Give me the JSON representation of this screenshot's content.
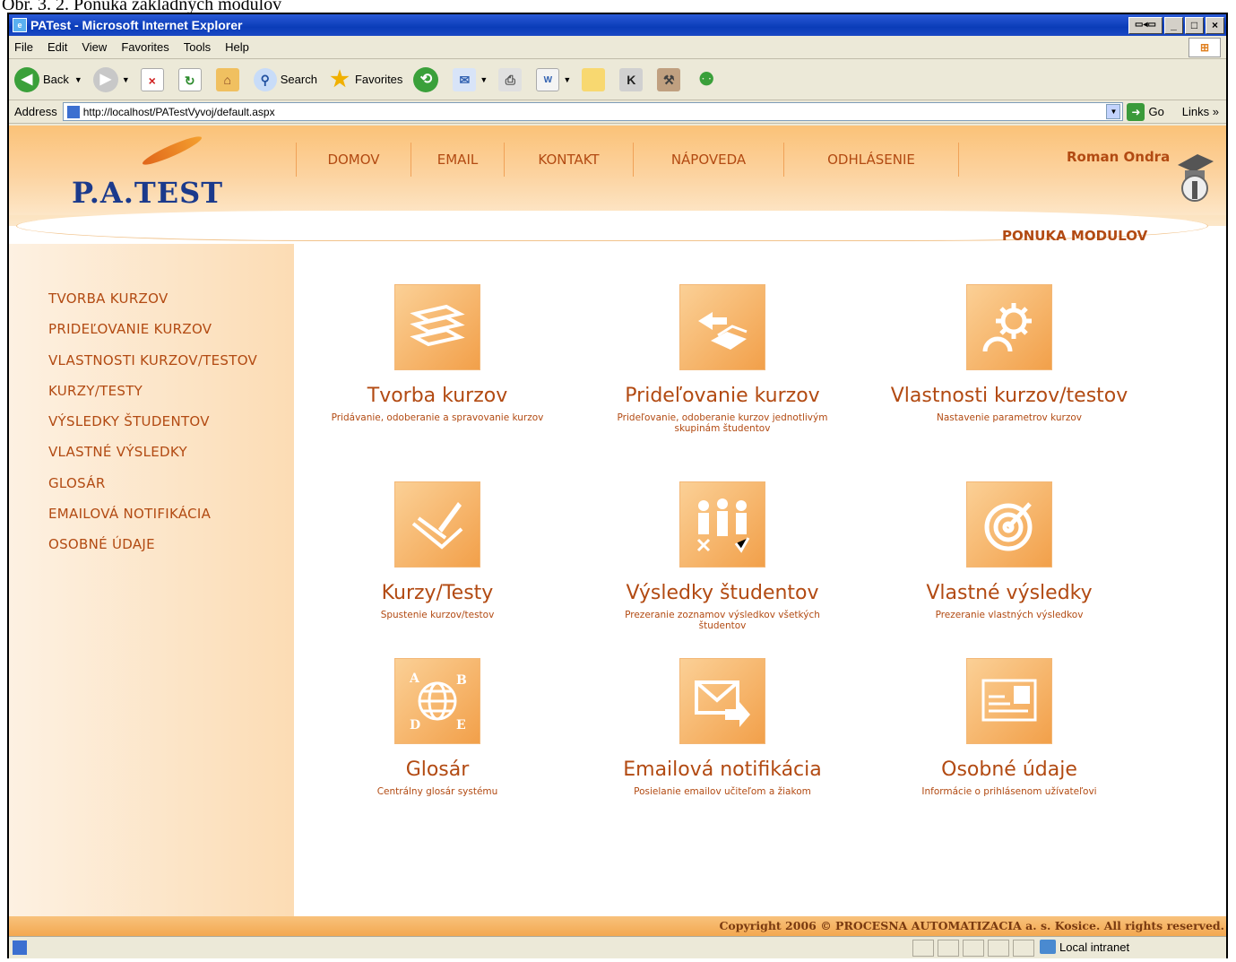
{
  "caption": "Obr. 3. 2. Ponuka základných modulov",
  "window": {
    "title": "PATest - Microsoft Internet Explorer"
  },
  "menubar": [
    "File",
    "Edit",
    "View",
    "Favorites",
    "Tools",
    "Help"
  ],
  "toolbar": {
    "back": "Back",
    "search": "Search",
    "favorites": "Favorites"
  },
  "address": {
    "label": "Address",
    "url": "http://localhost/PATestVyvoj/default.aspx",
    "go": "Go",
    "links": "Links"
  },
  "site": {
    "logo": "P.A.TEST",
    "nav": [
      "DOMOV",
      "EMAIL",
      "KONTAKT",
      "NÁPOVEDA",
      "ODHLÁSENIE"
    ],
    "user": "Roman Ondra",
    "section_title": "PONUKA MODULOV"
  },
  "sidebar": {
    "items": [
      "TVORBA KURZOV",
      "PRIDEĽOVANIE KURZOV",
      "VLASTNOSTI KURZOV/TESTOV",
      "KURZY/TESTY",
      "VÝSLEDKY ŠTUDENTOV",
      "VLASTNÉ VÝSLEDKY",
      "GLOSÁR",
      "EMAILOVÁ NOTIFIKÁCIA",
      "OSOBNÉ ÚDAJE"
    ]
  },
  "modules": [
    {
      "title": "Tvorba kurzov",
      "desc": "Pridávanie, odoberanie a spravovanie kurzov",
      "icon": "books-icon"
    },
    {
      "title": "Prideľovanie kurzov",
      "desc": "Prideľovanie, odoberanie kurzov jednotlivým skupinám študentov",
      "icon": "assign-book-icon"
    },
    {
      "title": "Vlastnosti kurzov/testov",
      "desc": "Nastavenie parametrov kurzov",
      "icon": "gears-icon"
    },
    {
      "title": "Kurzy/Testy",
      "desc": "Spustenie kurzov/testov",
      "icon": "pen-notebook-icon"
    },
    {
      "title": "Výsledky študentov",
      "desc": "Prezeranie zoznamov výsledkov všetkých študentov",
      "icon": "students-icon"
    },
    {
      "title": "Vlastné výsledky",
      "desc": "Prezeranie vlastných výsledkov",
      "icon": "target-icon"
    },
    {
      "title": "Glosár",
      "desc": "Centrálny glosár systému",
      "icon": "globe-letters-icon"
    },
    {
      "title": "Emailová notifikácia",
      "desc": "Posielanie emailov učiteľom a žiakom",
      "icon": "envelope-icon"
    },
    {
      "title": "Osobné údaje",
      "desc": "Informácie o prihlásenom užívateľovi",
      "icon": "id-card-icon"
    }
  ],
  "footer": "Copyright 2006 © PROCESNA AUTOMATIZACIA a. s. Kosice. All rights reserved.",
  "status": {
    "zone": "Local intranet"
  }
}
